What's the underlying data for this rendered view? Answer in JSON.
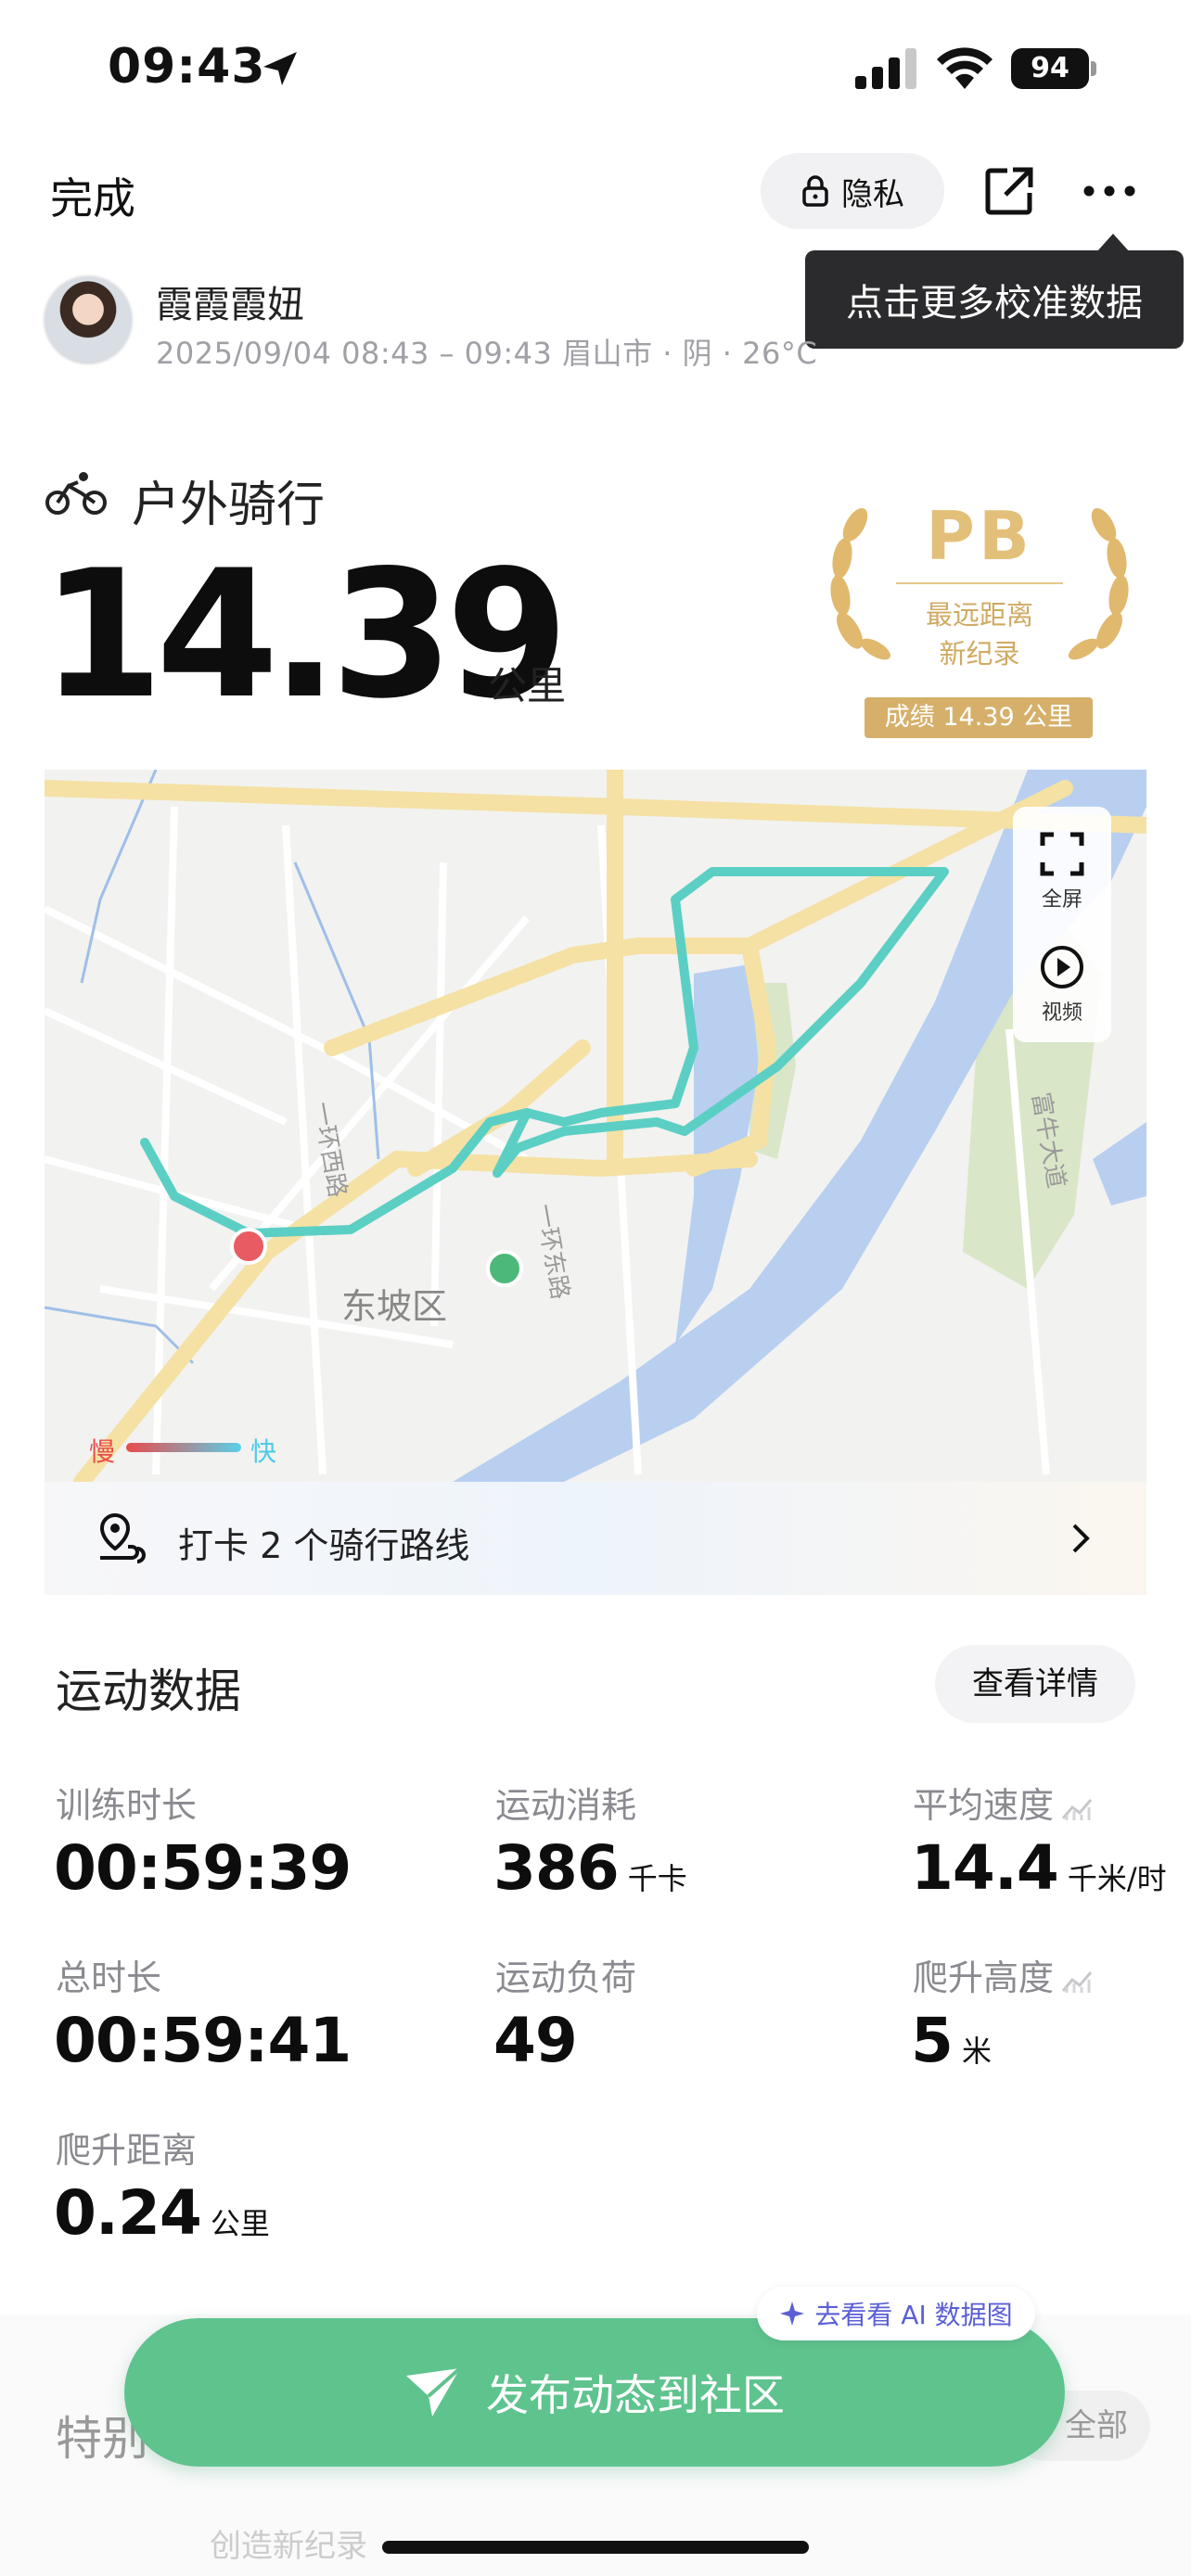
{
  "status_bar": {
    "time": "09:43",
    "battery": "94"
  },
  "nav": {
    "done_label": "完成",
    "privacy_label": "隐私",
    "tooltip": "点击更多校准数据"
  },
  "user": {
    "name": "霞霞霞妞",
    "meta": "2025/09/04 08:43 – 09:43 眉山市 · 阴 · 26°C"
  },
  "activity": {
    "type": "户外骑行",
    "distance": "14.39",
    "distance_unit": "公里"
  },
  "pb": {
    "letters": "PB",
    "line1": "最远距离",
    "line2": "新纪录",
    "score": "成绩 14.39 公里"
  },
  "map": {
    "fullscreen_label": "全屏",
    "video_label": "视频",
    "district_label": "东坡区",
    "speed_slow": "慢",
    "speed_fast": "快",
    "route_color": "#5ccfc4",
    "start_color": "#e95b62",
    "end_color": "#4cb87a"
  },
  "checkin": {
    "text": "打卡 2 个骑行路线"
  },
  "stats": {
    "title": "运动数据",
    "detail_label": "查看详情",
    "items": [
      {
        "label": "训练时长",
        "value": "00:59:39",
        "unit": ""
      },
      {
        "label": "运动消耗",
        "value": "386",
        "unit": "千卡"
      },
      {
        "label": "平均速度",
        "value": "14.4",
        "unit": "千米/时"
      },
      {
        "label": "总时长",
        "value": "00:59:41",
        "unit": ""
      },
      {
        "label": "运动负荷",
        "value": "49",
        "unit": ""
      },
      {
        "label": "爬升高度",
        "value": "5",
        "unit": "米"
      },
      {
        "label": "爬升距离",
        "value": "0.24",
        "unit": "公里"
      }
    ]
  },
  "bottom": {
    "ai_chip": "去看看 AI 数据图",
    "publish_label": "发布动态到社区",
    "section2_title": "特别",
    "view_all": "全部",
    "record_hint": "创造新纪录"
  }
}
